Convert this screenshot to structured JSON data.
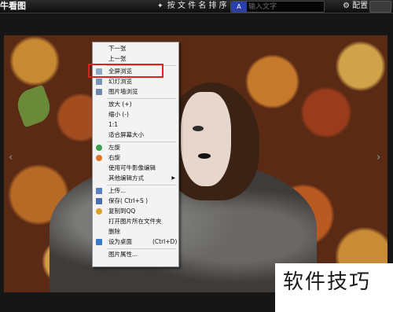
{
  "app": {
    "title": "牛看图"
  },
  "toolbar": {
    "sort_label": "按 文 件 名 排 序",
    "search_placeholder": "输入文字",
    "search_mode_label": "A",
    "settings_label": "配置"
  },
  "context_menu": {
    "items": [
      {
        "label": "下一张",
        "icon": ""
      },
      {
        "label": "上一张",
        "icon": ""
      },
      {
        "label": "全屏浏览",
        "icon": "fullscreen-icon",
        "highlighted": true
      },
      {
        "label": "幻灯浏览",
        "icon": "slideshow-icon"
      },
      {
        "label": "图片墙浏览",
        "icon": "photo-wall-icon"
      },
      {
        "label": "放大 (+)",
        "icon": ""
      },
      {
        "label": "缩小 (-)",
        "icon": ""
      },
      {
        "label": "1:1",
        "icon": ""
      },
      {
        "label": "适合屏幕大小",
        "icon": ""
      },
      {
        "label": "左旋",
        "icon": "rotate-left-icon"
      },
      {
        "label": "右旋",
        "icon": "rotate-right-icon"
      },
      {
        "label": "使用可牛影像编辑",
        "icon": ""
      },
      {
        "label": "其他编辑方式",
        "icon": "",
        "submenu": true
      },
      {
        "label": "上传...",
        "icon": "upload-icon"
      },
      {
        "label": "保存( Ctrl+S )",
        "icon": "save-icon"
      },
      {
        "label": "复制到QQ",
        "icon": "qq-icon"
      },
      {
        "label": "打开图片所在文件夹",
        "icon": ""
      },
      {
        "label": "删除",
        "icon": ""
      },
      {
        "label": "设为桌面",
        "shortcut": "(Ctrl+D)",
        "icon": "desktop-icon"
      },
      {
        "label": "图片属性...",
        "icon": ""
      }
    ]
  },
  "watermark": {
    "text": "软件技巧"
  },
  "colors": {
    "highlight_border": "#e02020",
    "menu_bg": "#f3f3f3",
    "search_mode_bg": "#2a3fa8"
  }
}
